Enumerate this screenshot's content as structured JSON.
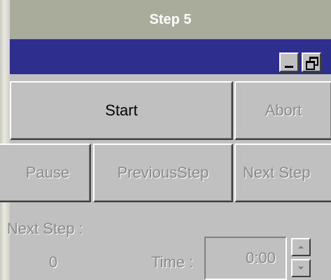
{
  "header": {
    "title": "Step 5"
  },
  "window": {
    "buttons": {
      "start": "Start",
      "abort": "Abort",
      "pause": "Pause",
      "previous_step": "PreviousStep",
      "next_step": "Next Step"
    },
    "next_step_label": "Next Step :",
    "next_step_value": "0",
    "time_label": "Time :",
    "time_value": "0:00",
    "titlebar_icons": [
      "minimize-icon",
      "restore-icon"
    ],
    "colors": {
      "titlebar": "#2e2e8f",
      "face": "#c0c0c0",
      "header": "#a9ab9b"
    }
  }
}
